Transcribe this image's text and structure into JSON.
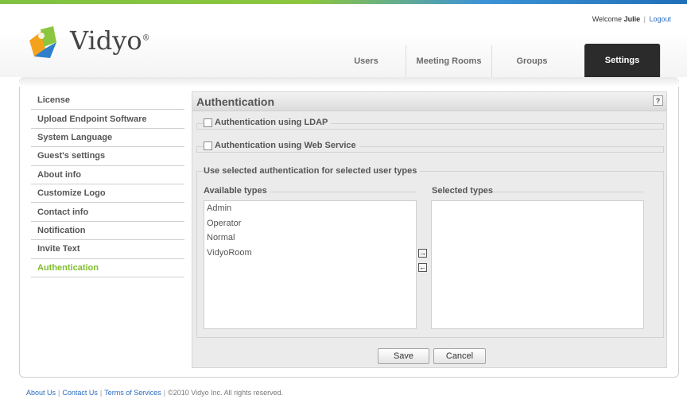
{
  "header": {
    "welcome_prefix": "Welcome",
    "user_name": "Julie",
    "logout_label": "Logout",
    "logo_text": "Vidyo",
    "logo_reg": "®"
  },
  "tabs": [
    {
      "label": "Users"
    },
    {
      "label": "Meeting Rooms"
    },
    {
      "label": "Groups"
    },
    {
      "label": "Settings",
      "active": true
    }
  ],
  "sidebar": {
    "items": [
      {
        "label": "License"
      },
      {
        "label": "Upload Endpoint Software"
      },
      {
        "label": "System Language"
      },
      {
        "label": "Guest's settings"
      },
      {
        "label": "About info"
      },
      {
        "label": "Customize Logo"
      },
      {
        "label": "Contact info"
      },
      {
        "label": "Notification"
      },
      {
        "label": "Invite Text"
      },
      {
        "label": "Authentication",
        "active": true
      }
    ]
  },
  "panel": {
    "title": "Authentication",
    "help_label": "?",
    "ldap_label": "Authentication using LDAP",
    "ldap_checked": false,
    "webservice_label": "Authentication using Web Service",
    "webservice_checked": false,
    "user_types_label": "Use selected authentication for selected user types",
    "available_label": "Available types",
    "selected_label": "Selected types",
    "available_types": [
      "Admin",
      "Operator",
      "Normal",
      "VidyoRoom"
    ],
    "selected_types": [],
    "move_right_glyph": "→",
    "move_left_glyph": "←",
    "save_label": "Save",
    "cancel_label": "Cancel"
  },
  "footer": {
    "about_label": "About Us",
    "contact_label": "Contact Us",
    "terms_label": "Terms of Services",
    "copyright": "©2010 Vidyo Inc. All rights reserved."
  },
  "colors": {
    "accent_green": "#80bd2d",
    "link_blue": "#2a6bbf",
    "active_tab_bg": "#2b2b2b"
  }
}
